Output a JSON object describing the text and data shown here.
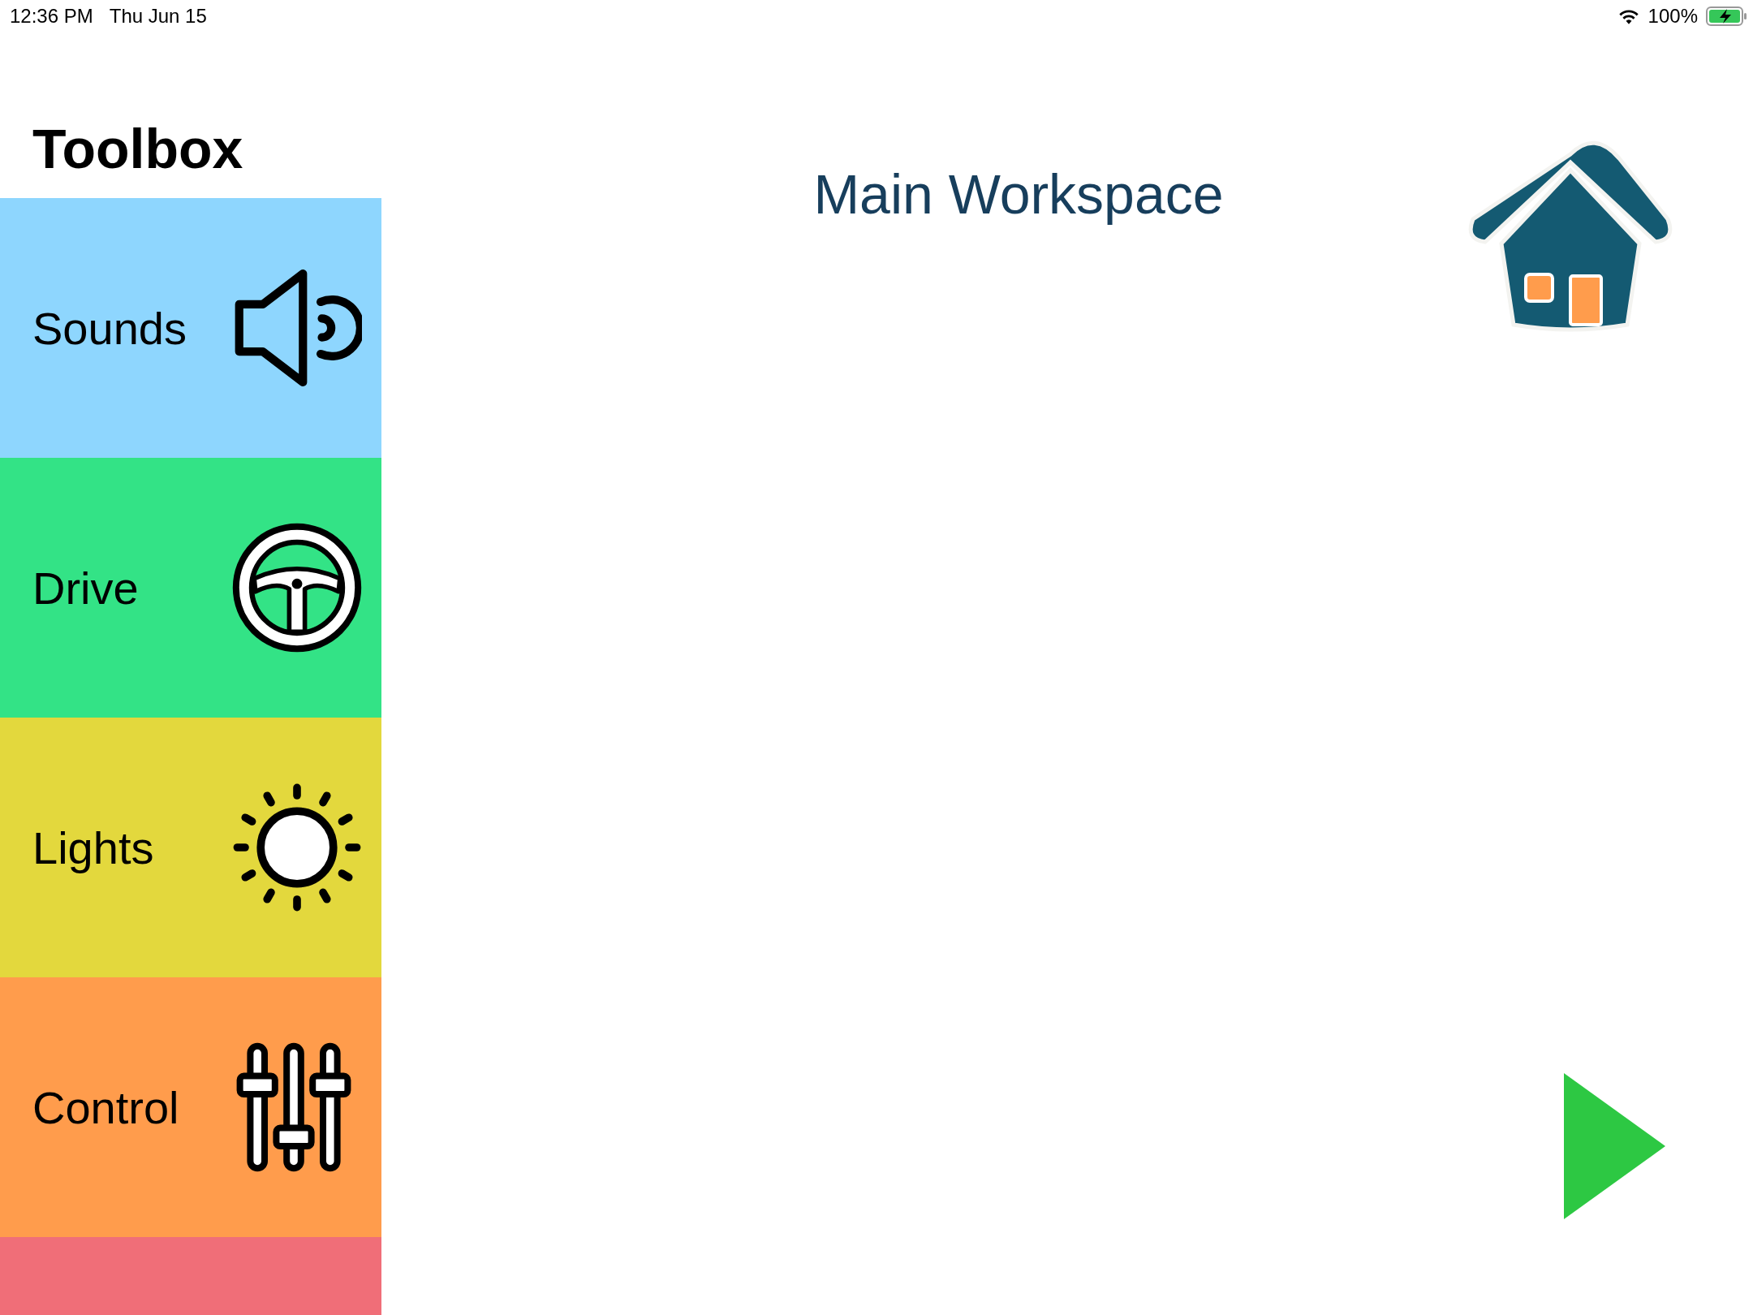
{
  "status_bar": {
    "time": "12:36 PM",
    "date": "Thu Jun 15",
    "battery": "100%"
  },
  "toolbox": {
    "title": "Toolbox",
    "categories": [
      {
        "kind": "sounds",
        "label": "Sounds",
        "color": "#8ed6fe"
      },
      {
        "kind": "drive",
        "label": "Drive",
        "color": "#33e386"
      },
      {
        "kind": "lights",
        "label": "Lights",
        "color": "#e3d83d"
      },
      {
        "kind": "control",
        "label": "Control",
        "color": "#ff9c4c"
      },
      {
        "kind": "partial",
        "color": "#f06e78"
      }
    ]
  },
  "workspace": {
    "title": "Main Workspace"
  }
}
